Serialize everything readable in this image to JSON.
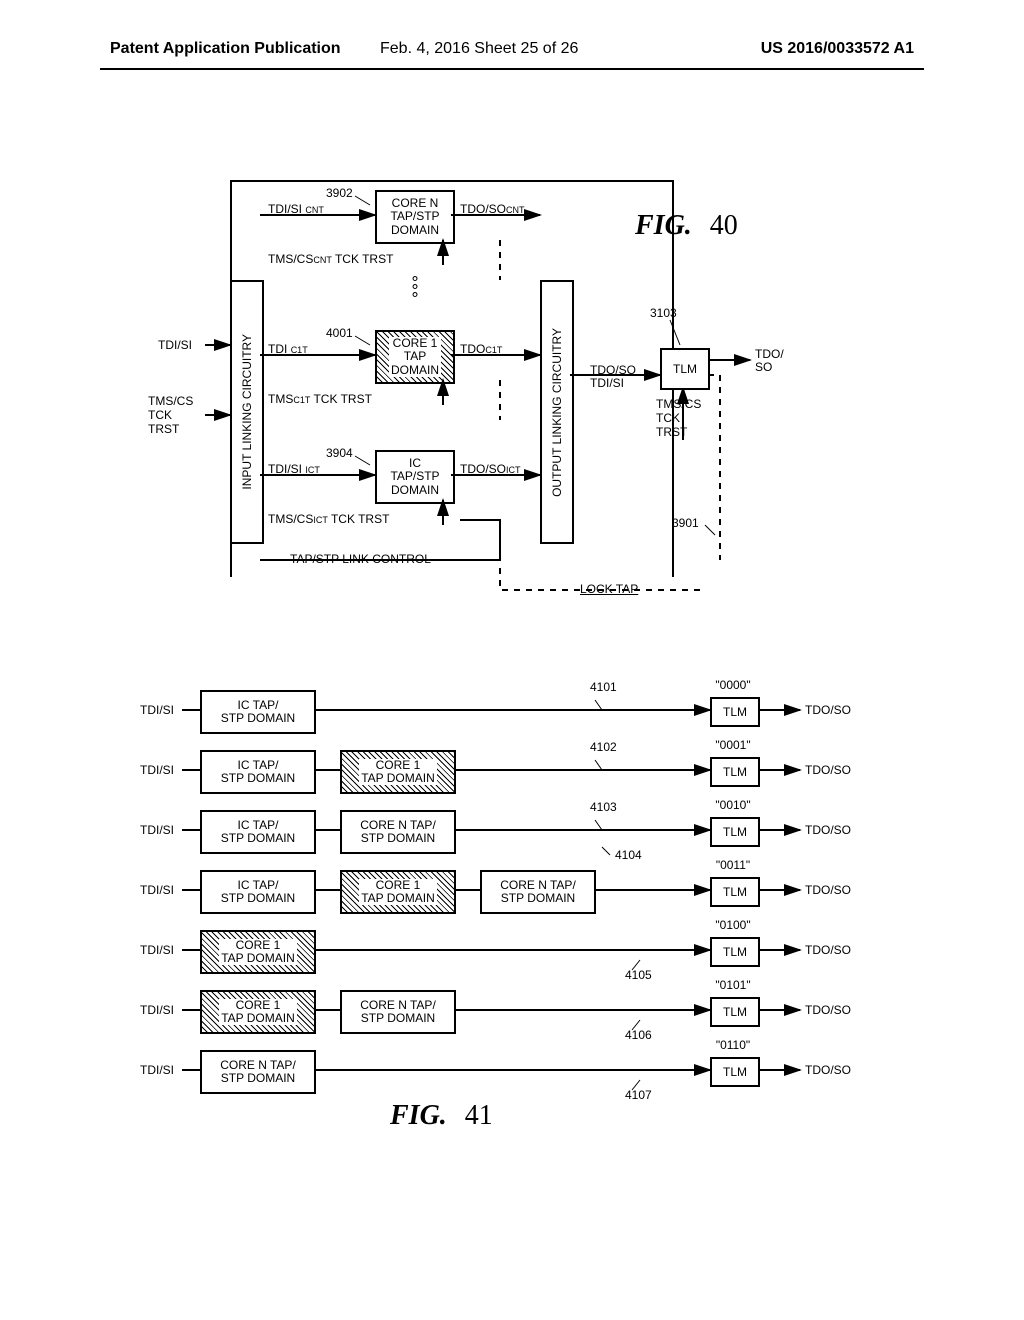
{
  "header": {
    "left": "Patent Application Publication",
    "center": "Feb. 4, 2016  Sheet 25 of 26",
    "right": "US 2016/0033572 A1"
  },
  "fig40": {
    "title": "FIG.",
    "num": "40",
    "input_block": "INPUT LINKING CIRCUITRY",
    "output_block": "OUTPUT LINKING CIRCUITRY",
    "in_tdisi": "TDI/SI",
    "in_tms": "TMS/CS\nTCK\nTRST",
    "coreN": "CORE N\nTAP/STP\nDOMAIN",
    "core1": "CORE 1\nTAP\nDOMAIN",
    "icTap": "IC\nTAP/STP\nDOMAIN",
    "tlm": "TLM",
    "coreN_tdi": "TDI/SI",
    "coreN_tdi_sub": "CNT",
    "coreN_tms": "TMS/CS",
    "coreN_tms_sub": "CNT",
    "coreN_tms_rest": " TCK TRST",
    "coreN_tdo": "TDO/SO",
    "coreN_tdo_sub": "CNT",
    "core1_tdi": "TDI",
    "core1_tdi_sub": "C1T",
    "core1_tms": "TMS",
    "core1_tms_sub": "C1T",
    "core1_tms_rest": " TCK TRST",
    "core1_tdo": "TDO",
    "core1_tdo_sub": "C1T",
    "ic_tdi": "TDI/SI",
    "ic_tdi_sub": "ICT",
    "ic_tms": "TMS/CS",
    "ic_tms_sub": "ICT",
    "ic_tms_rest": " TCK TRST",
    "ic_tdo": "TDO/SO",
    "ic_tdo_sub": "ICT",
    "ref_3902": "3902",
    "ref_4001": "4001",
    "ref_3904": "3904",
    "ref_3103": "3103",
    "ref_3901": "3901",
    "tap_link": "TAP/STP LINK CONTROL",
    "tlm_in1": "TDO/SO\nTDI/SI",
    "tlm_in2": "TMS/CS\nTCK\nTRST",
    "tlm_out": "TDO/\nSO",
    "lock_tap": "LOCK TAP"
  },
  "fig41": {
    "title": "FIG.",
    "num": "41",
    "tdisi": "TDI/SI",
    "tdoso": "TDO/SO",
    "tlm": "TLM",
    "ic_tap": "IC TAP/\nSTP DOMAIN",
    "core1": "CORE 1\nTAP DOMAIN",
    "coreN": "CORE N TAP/\nSTP DOMAIN",
    "bits": [
      "\"0000\"",
      "\"0001\"",
      "\"0010\"",
      "\"0011\"",
      "\"0100\"",
      "\"0101\"",
      "\"0110\""
    ],
    "refs": [
      "4101",
      "4102",
      "4103",
      "4104",
      "4105",
      "4106",
      "4107"
    ]
  }
}
